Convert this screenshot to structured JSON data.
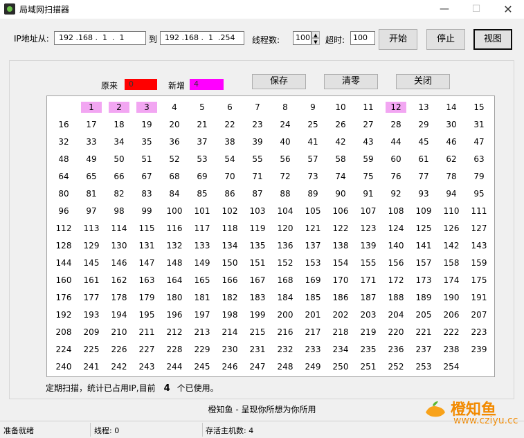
{
  "window": {
    "title": "局域网扫描器",
    "minimize": "—",
    "maximize": "☐",
    "close": "✕"
  },
  "toolbar": {
    "ip_from_label": "IP地址从:",
    "ip_from": "192 .168 .  1  .  1",
    "to_label": "到",
    "ip_to": "192 .168 .  1  .254",
    "threads_label": "线程数:",
    "threads": "100",
    "timeout_label": "超时:",
    "timeout": "100",
    "start": "开始",
    "stop": "停止",
    "view": "视图"
  },
  "legend": {
    "original_label": "原来",
    "original_value": "0",
    "original_color": "#ff0000",
    "new_label": "新增",
    "new_value": "4",
    "new_color": "#ff00ff"
  },
  "actions": {
    "save": "保存",
    "clear": "清零",
    "close": "关闭"
  },
  "grid": {
    "highlighted": [
      1,
      2,
      3,
      12
    ],
    "highlight_color": "#f2a6f2",
    "cells": [
      1,
      2,
      3,
      4,
      5,
      6,
      7,
      8,
      9,
      10,
      11,
      12,
      13,
      14,
      15,
      16,
      17,
      18,
      19,
      20,
      21,
      22,
      23,
      24,
      25,
      26,
      27,
      28,
      29,
      30,
      31,
      32,
      33,
      34,
      35,
      36,
      37,
      38,
      39,
      40,
      41,
      42,
      43,
      44,
      45,
      46,
      47,
      48,
      49,
      50,
      51,
      52,
      53,
      54,
      55,
      56,
      57,
      58,
      59,
      60,
      61,
      62,
      63,
      64,
      65,
      66,
      67,
      68,
      69,
      70,
      71,
      72,
      73,
      74,
      75,
      76,
      77,
      78,
      79,
      80,
      81,
      82,
      83,
      84,
      85,
      86,
      87,
      88,
      89,
      90,
      91,
      92,
      93,
      94,
      95,
      96,
      97,
      98,
      99,
      100,
      101,
      102,
      103,
      104,
      105,
      106,
      107,
      108,
      109,
      110,
      111,
      112,
      113,
      114,
      115,
      116,
      117,
      118,
      119,
      120,
      121,
      122,
      123,
      124,
      125,
      126,
      127,
      128,
      129,
      130,
      131,
      132,
      133,
      134,
      135,
      136,
      137,
      138,
      139,
      140,
      141,
      142,
      143,
      144,
      145,
      146,
      147,
      148,
      149,
      150,
      151,
      152,
      153,
      154,
      155,
      156,
      157,
      158,
      159,
      160,
      161,
      162,
      163,
      164,
      165,
      166,
      167,
      168,
      169,
      170,
      171,
      172,
      173,
      174,
      175,
      176,
      177,
      178,
      179,
      180,
      181,
      182,
      183,
      184,
      185,
      186,
      187,
      188,
      189,
      190,
      191,
      192,
      193,
      194,
      195,
      196,
      197,
      198,
      199,
      200,
      201,
      202,
      203,
      204,
      205,
      206,
      207,
      208,
      209,
      210,
      211,
      212,
      213,
      214,
      215,
      216,
      217,
      218,
      219,
      220,
      221,
      222,
      223,
      224,
      225,
      226,
      227,
      228,
      229,
      230,
      231,
      232,
      233,
      234,
      235,
      236,
      237,
      238,
      239,
      240,
      241,
      242,
      243,
      244,
      245,
      246,
      247,
      248,
      249,
      250,
      251,
      252,
      253,
      254
    ]
  },
  "footer": {
    "prefix": "定期扫描，统计已占用IP,目前",
    "count": "4",
    "suffix": "个已使用。"
  },
  "slogan": "橙知鱼 - 呈现你所想为你所用",
  "watermark": {
    "name": "橙知鱼",
    "url": "www.cziyu.cc",
    "color": "#f28a00"
  },
  "status": {
    "ready": "准备就绪",
    "threads": "线程:  0",
    "alive": "存活主机数: 4"
  }
}
